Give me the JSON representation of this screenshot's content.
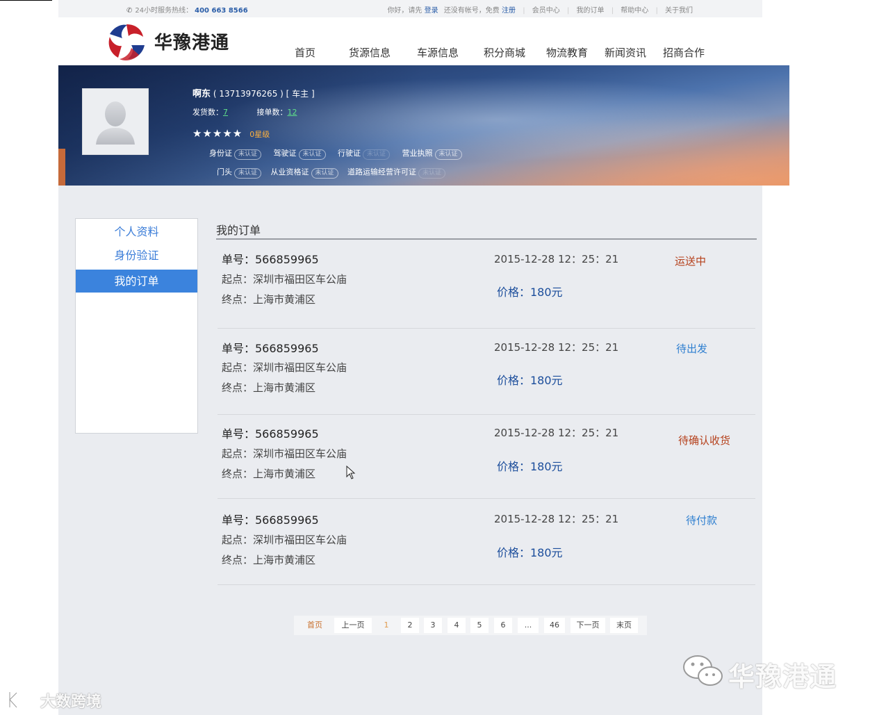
{
  "topbar": {
    "hotline_label": "24小时服务热线：",
    "hotline_number": "400 663 8566",
    "greeting": "你好，请先",
    "login": "登录",
    "no_account": "还没有帐号，免费",
    "register": "注册",
    "links": [
      "会员中心",
      "我的订单",
      "帮助中心",
      "关于我们"
    ]
  },
  "logo": {
    "text": "华豫港通"
  },
  "nav": [
    "首页",
    "货源信息",
    "车源信息",
    "积分商城",
    "物流教育",
    "新闻资讯",
    "招商合作"
  ],
  "profile": {
    "name": "啊东",
    "phone": "( 13713976265 )",
    "role": "[ 车主 ]",
    "shipments_label": "发货数：",
    "shipments": "7",
    "orders_label": "接单数：",
    "orders": "12",
    "stars": "★★★★★",
    "level": "0星级",
    "certs_row1": [
      {
        "label": "身份证",
        "badge": "未认证"
      },
      {
        "label": "驾驶证",
        "badge": "未认证"
      },
      {
        "label": "行驶证",
        "badge": "未认证"
      },
      {
        "label": "营业执照",
        "badge": "未认证"
      }
    ],
    "certs_row2": [
      {
        "label": "门头",
        "badge": "未认证"
      },
      {
        "label": "从业资格证",
        "badge": "未认证"
      },
      {
        "label": "道路运输经营许可证",
        "badge": "未认证"
      }
    ]
  },
  "sidebar": {
    "items": [
      {
        "label": "个人资料"
      },
      {
        "label": "身份验证"
      },
      {
        "label": "我的订单"
      }
    ]
  },
  "orders_section": {
    "title": "我的订单",
    "orders": [
      {
        "no": "单号：566859965",
        "from": "起点：深圳市福田区车公庙",
        "to": "终点：上海市黄浦区",
        "time": "2015-12-28  12：25：21",
        "price": "价格：180元",
        "status": "运送中",
        "status_color": "#b5401b"
      },
      {
        "no": "单号：566859965",
        "from": "起点：深圳市福田区车公庙",
        "to": "终点：上海市黄浦区",
        "time": "2015-12-28  12：25：21",
        "price": "价格：180元",
        "status": "待出发",
        "status_color": "#2f7fd0"
      },
      {
        "no": "单号：566859965",
        "from": "起点：深圳市福田区车公庙",
        "to": "终点：上海市黄浦区",
        "time": "2015-12-28  12：25：21",
        "price": "价格：180元",
        "status": "待确认收货",
        "status_color": "#b5401b"
      },
      {
        "no": "单号：566859965",
        "from": "起点：深圳市福田区车公庙",
        "to": "终点：上海市黄浦区",
        "time": "2015-12-28  12：25：21",
        "price": "价格：180元",
        "status": "待付款",
        "status_color": "#2f7fd0"
      }
    ]
  },
  "pagination": {
    "first": "首页",
    "prev": "上一页",
    "pages": [
      "1",
      "2",
      "3",
      "4",
      "5",
      "6",
      "...",
      "46"
    ],
    "current": "1",
    "next": "下一页",
    "last": "末页"
  },
  "watermarks": {
    "right": "华豫港通",
    "left": "大数跨境"
  }
}
